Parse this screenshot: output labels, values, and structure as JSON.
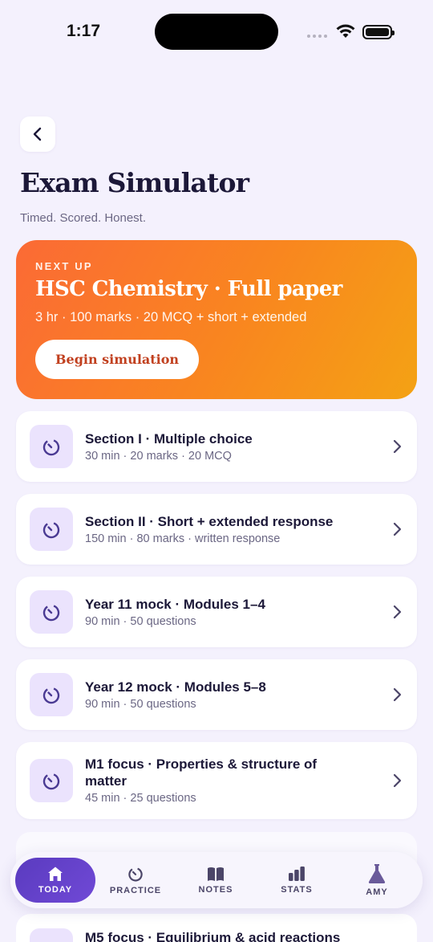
{
  "status_bar": {
    "time": "1:17"
  },
  "header": {
    "title": "Exam Simulator",
    "subtitle": "Timed. Scored. Honest."
  },
  "hero": {
    "eyebrow": "NEXT UP",
    "title": "HSC Chemistry · Full paper",
    "meta": "3 hr · 100 marks · 20 MCQ + short + extended",
    "button_label": "Begin simulation"
  },
  "exams": [
    {
      "title": "Section I · Multiple choice",
      "meta": "30 min · 20 marks · 20 MCQ"
    },
    {
      "title": "Section II · Short + extended response",
      "meta": "150 min · 80 marks · written response"
    },
    {
      "title": "Year 11 mock · Modules 1–4",
      "meta": "90 min · 50 questions"
    },
    {
      "title": "Year 12 mock · Modules 5–8",
      "meta": "90 min · 50 questions"
    },
    {
      "title": "M1 focus · Properties & structure of matter",
      "meta": "45 min · 25 questions"
    },
    {
      "title": "M5 focus · Equilibrium & acid reactions"
    }
  ],
  "tabbar": {
    "tabs": [
      {
        "label": "TODAY",
        "icon": "home-icon"
      },
      {
        "label": "PRACTICE",
        "icon": "timer-icon"
      },
      {
        "label": "NOTES",
        "icon": "book-icon"
      },
      {
        "label": "STATS",
        "icon": "bar-chart-icon"
      },
      {
        "label": "AMY",
        "icon": "flask-icon"
      }
    ]
  },
  "colors": {
    "background": "#f4f1fd",
    "hero_gradient_start": "#fb6a35",
    "hero_gradient_end": "#f4a214",
    "accent": "#5a3bbf",
    "icon_tile": "#ebe3fd"
  }
}
